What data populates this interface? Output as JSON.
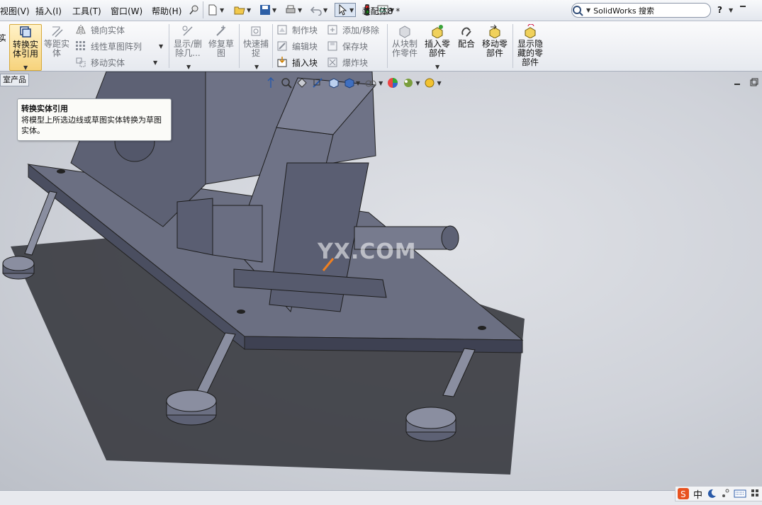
{
  "menu": {
    "items": [
      "视图(V)",
      "插入(I)",
      "工具(T)",
      "窗口(W)",
      "帮助(H)"
    ]
  },
  "title": "装配体8 *",
  "search": {
    "placeholder": "SolidWorks 搜索"
  },
  "help_label": "?",
  "command_manager": {
    "partial_left": "实",
    "convert_entities": "转换实体引用",
    "offset_entities": "等距实体",
    "mirror_entities": "镜向实体",
    "linear_pattern": "线性草图阵列",
    "move_entities": "移动实体",
    "show_delete": "显示/删除几...",
    "repair_sketch": "修复草图",
    "quick_snaps": "快速捕捉",
    "make_block": "制作块",
    "edit_block": "编辑块",
    "insert_block": "插入块",
    "add_remove": "添加/移除",
    "save_block": "保存块",
    "explode_block": "爆炸块",
    "make_part_from_block": "从块制作零件",
    "insert_component": "插入零部件",
    "mate": "配合",
    "move_component": "移动零部件",
    "show_hidden_components": "显示隐藏的零部件"
  },
  "feature_tab": "室产品",
  "tooltip": {
    "title": "转换实体引用",
    "description": "将模型上所选边线或草图实体转换为草图实体。"
  },
  "watermark": "YX.COM",
  "ime": {
    "label": "中"
  },
  "colors": {
    "viewport_bg": "#cfd2d9",
    "model_face": "#6b6f82",
    "model_dark": "#3e4152",
    "shadow": "#2f3036",
    "accent_orange": "#f08020"
  }
}
